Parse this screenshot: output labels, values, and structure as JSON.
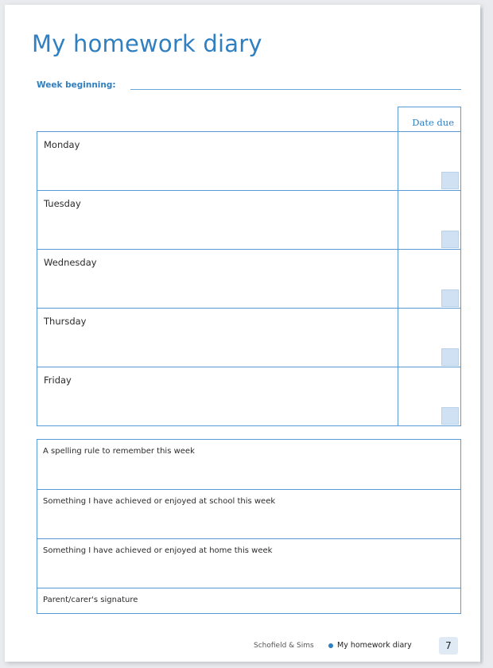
{
  "page": {
    "title": "My homework diary",
    "week_beginning_label": "Week beginning:",
    "date_due_header": "Date due"
  },
  "days": [
    {
      "label": "Monday"
    },
    {
      "label": "Tuesday"
    },
    {
      "label": "Wednesday"
    },
    {
      "label": "Thursday"
    },
    {
      "label": "Friday"
    }
  ],
  "notes": [
    {
      "label": "A spelling rule to remember this week"
    },
    {
      "label": "Something I have achieved or enjoyed at school this week"
    },
    {
      "label": "Something I have achieved or enjoyed at home this week"
    },
    {
      "label": "Parent/carer's signature"
    }
  ],
  "footer": {
    "publisher": "Schofield & Sims",
    "book_title": "My homework diary",
    "page_number": "7"
  },
  "colors": {
    "accent": "#2f7fc1",
    "rule": "#5b9bd5",
    "tick_box": "#cfe1f2"
  }
}
